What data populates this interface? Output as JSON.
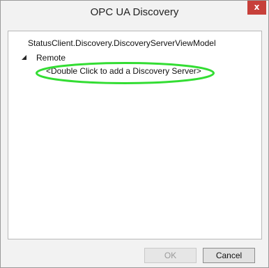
{
  "window": {
    "title": "OPC UA Discovery",
    "close_icon": "close-icon",
    "close_label": "x"
  },
  "tree": {
    "root_label": "StatusClient.Discovery.DiscoveryServerViewModel",
    "expand_icon": "collapse-triangle-icon",
    "remote_label": "Remote",
    "add_server_label": "<Double Click to add a Discovery Server>"
  },
  "buttons": {
    "ok_label": "OK",
    "cancel_label": "Cancel"
  },
  "colors": {
    "close_button": "#c7403a",
    "highlight": "#33dd33"
  }
}
